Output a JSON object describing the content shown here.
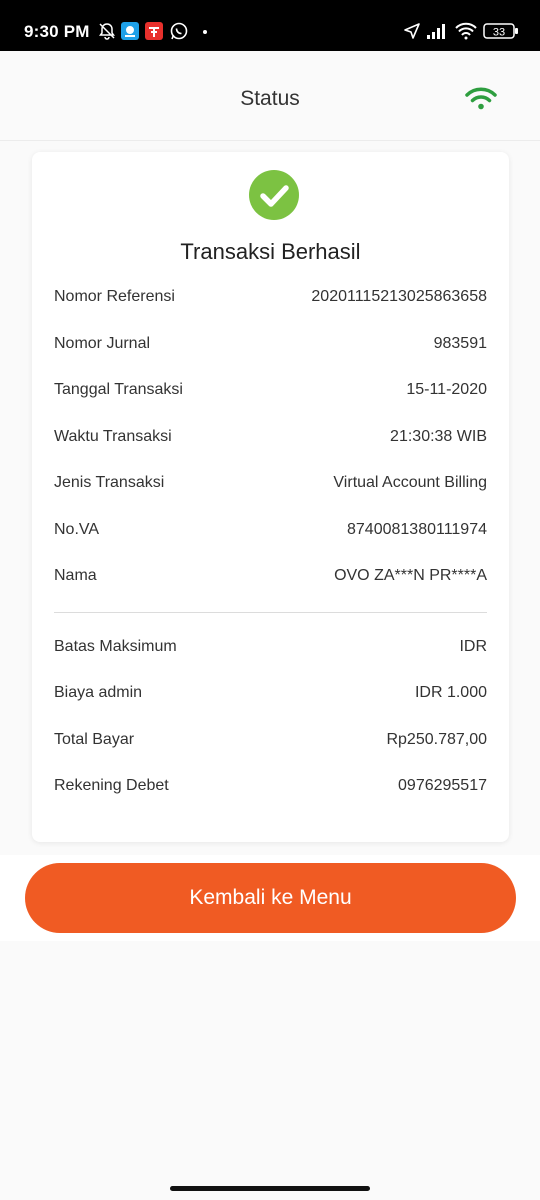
{
  "status_bar": {
    "time": "9:30 PM",
    "battery": "33",
    "icons": [
      "muted-bell-icon",
      "app-notification-icon",
      "app-notification-icon",
      "whatsapp-icon",
      "location-arrow-icon",
      "signal-icon",
      "wifi-icon",
      "battery-icon"
    ]
  },
  "header": {
    "title": "Status",
    "connection_icon": "wifi-icon",
    "connection_color": "#2e9e3f"
  },
  "card": {
    "headline": "Transaksi Berhasil",
    "success_color": "#7cc242",
    "details": [
      {
        "label": "Nomor Referensi",
        "value": "20201115213025863658"
      },
      {
        "label": "Nomor Jurnal",
        "value": "983591"
      },
      {
        "label": "Tanggal Transaksi",
        "value": "15-11-2020"
      },
      {
        "label": "Waktu Transaksi",
        "value": "21:30:38 WIB"
      },
      {
        "label": "Jenis Transaksi",
        "value": "Virtual Account Billing"
      },
      {
        "label": "No.VA",
        "value": "8740081380111974"
      },
      {
        "label": "Nama",
        "value": "OVO ZA***N PR****A"
      }
    ],
    "payment": [
      {
        "label": "Batas Maksimum",
        "value": "IDR"
      },
      {
        "label": "Biaya admin",
        "value": "IDR 1.000"
      },
      {
        "label": "Total Bayar",
        "value": "Rp250.787,00"
      },
      {
        "label": "Rekening Debet",
        "value": "0976295517"
      }
    ]
  },
  "button": {
    "label": "Kembali ke Menu",
    "color": "#f05b23"
  }
}
